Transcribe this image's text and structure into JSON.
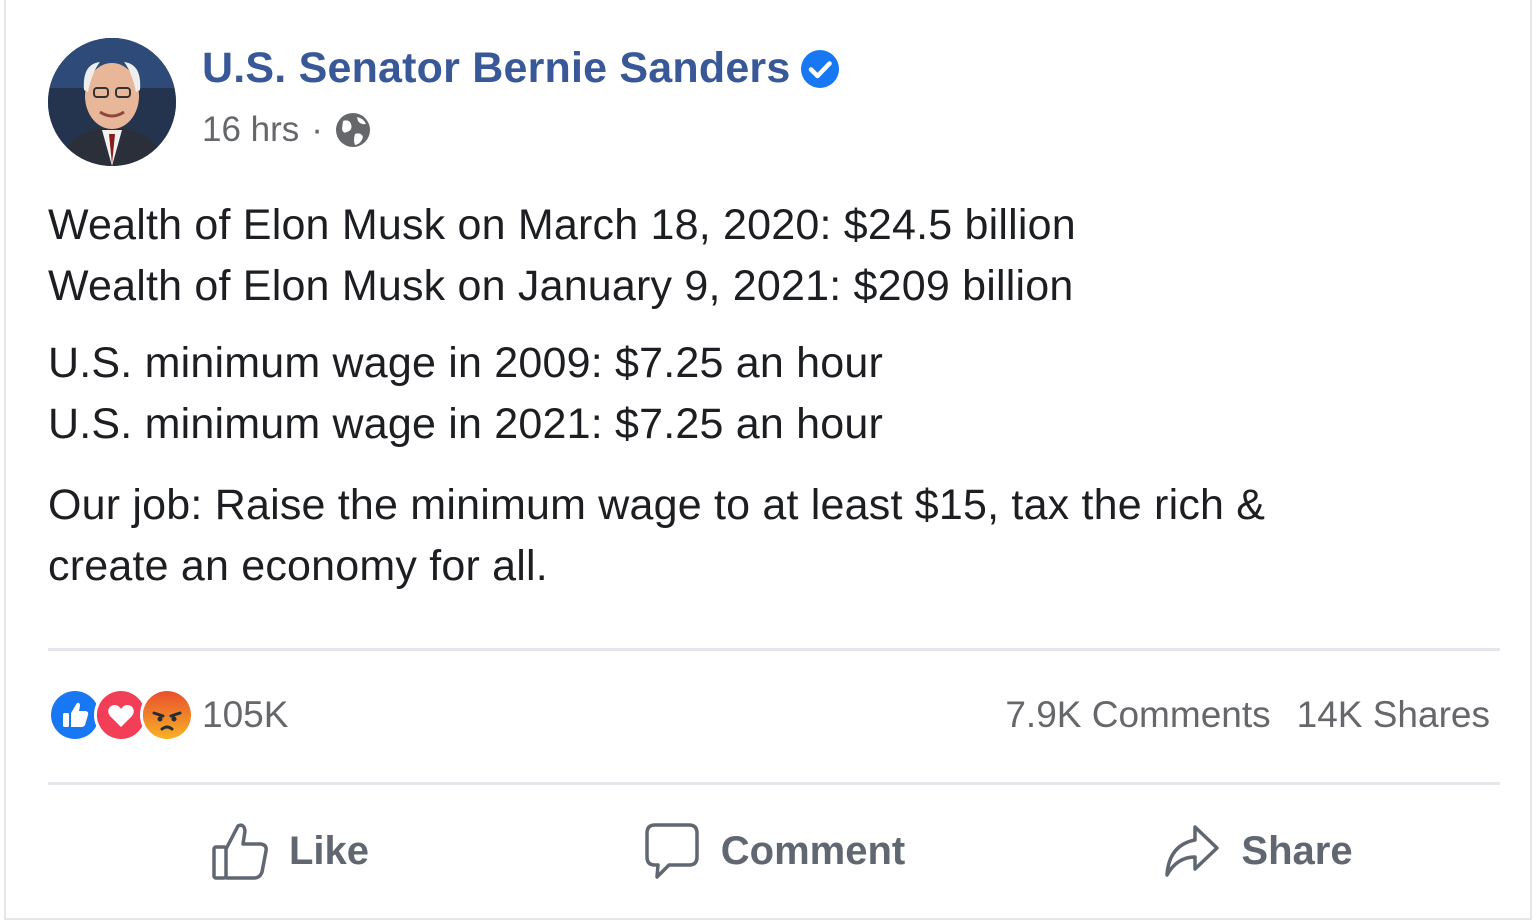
{
  "post": {
    "author": "U.S. Senator Bernie Sanders",
    "time": "16 hrs",
    "separator": "·",
    "lines": {
      "l1": "Wealth of Elon Musk on March 18, 2020: $24.5 billion",
      "l2": "Wealth of Elon Musk on January 9, 2021: $209 billion",
      "l3": "U.S. minimum wage in 2009: $7.25 an hour",
      "l4": "U.S. minimum wage in 2021: $7.25 an hour",
      "l5": "Our job: Raise the minimum wage to at least $15, tax the rich &",
      "l6": "create an economy for all."
    }
  },
  "engagement": {
    "reaction_icons": [
      "like-icon",
      "love-icon",
      "angry-icon"
    ],
    "reactions_count": "105K",
    "comments": "7.9K Comments",
    "shares": "14K Shares"
  },
  "actions": {
    "like": "Like",
    "comment": "Comment",
    "share": "Share"
  },
  "colors": {
    "author": "#385898",
    "verified": "#1877f2",
    "like": "#1877f2",
    "love": "#f33e58",
    "angry": "#f7714c",
    "muted": "#65676b"
  }
}
